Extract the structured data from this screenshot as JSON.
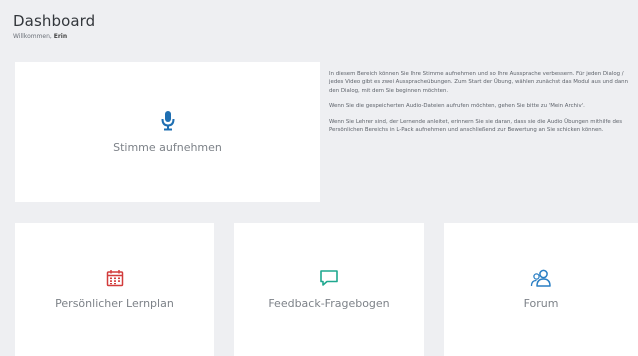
{
  "header": {
    "title": "Dashboard",
    "welcome_prefix": "Willkommen,",
    "user_name": "Erin"
  },
  "record_card": {
    "label": "Stimme aufnehmen",
    "icon": "microphone-icon",
    "icon_color": "#1f6fb2"
  },
  "info": {
    "paragraph_1": "In diesem Bereich können Sie Ihre Stimme aufnehmen und so Ihre Aussprache verbessern. Für jeden Dialog / jedes Video gibt es zwei Ausspracheübungen. Zum Start der Übung, wählen zunächst das Modul aus und dann den Dialog, mit dem Sie beginnen möchten.",
    "paragraph_2": "Wenn Sie die gespeicherten Audio-Dateien aufrufen möchten, gehen Sie bitte zu 'Mein Archiv'.",
    "paragraph_3": "Wenn Sie Lehrer sind, der Lernende anleitet, erinnern Sie sie daran, dass sie die Audio Übungen mithilfe des Persönlichen Bereichs in L-Pack aufnehmen und anschließend zur Bewertung an Sie schicken können."
  },
  "tiles": [
    {
      "label": "Persönlicher Lernplan",
      "icon": "calendar-icon",
      "icon_color": "#d23c3c"
    },
    {
      "label": "Feedback-Fragebogen",
      "icon": "speech-bubble-icon",
      "icon_color": "#1fa88f"
    },
    {
      "label": "Forum",
      "icon": "users-icon",
      "icon_color": "#2a7fc4"
    }
  ]
}
